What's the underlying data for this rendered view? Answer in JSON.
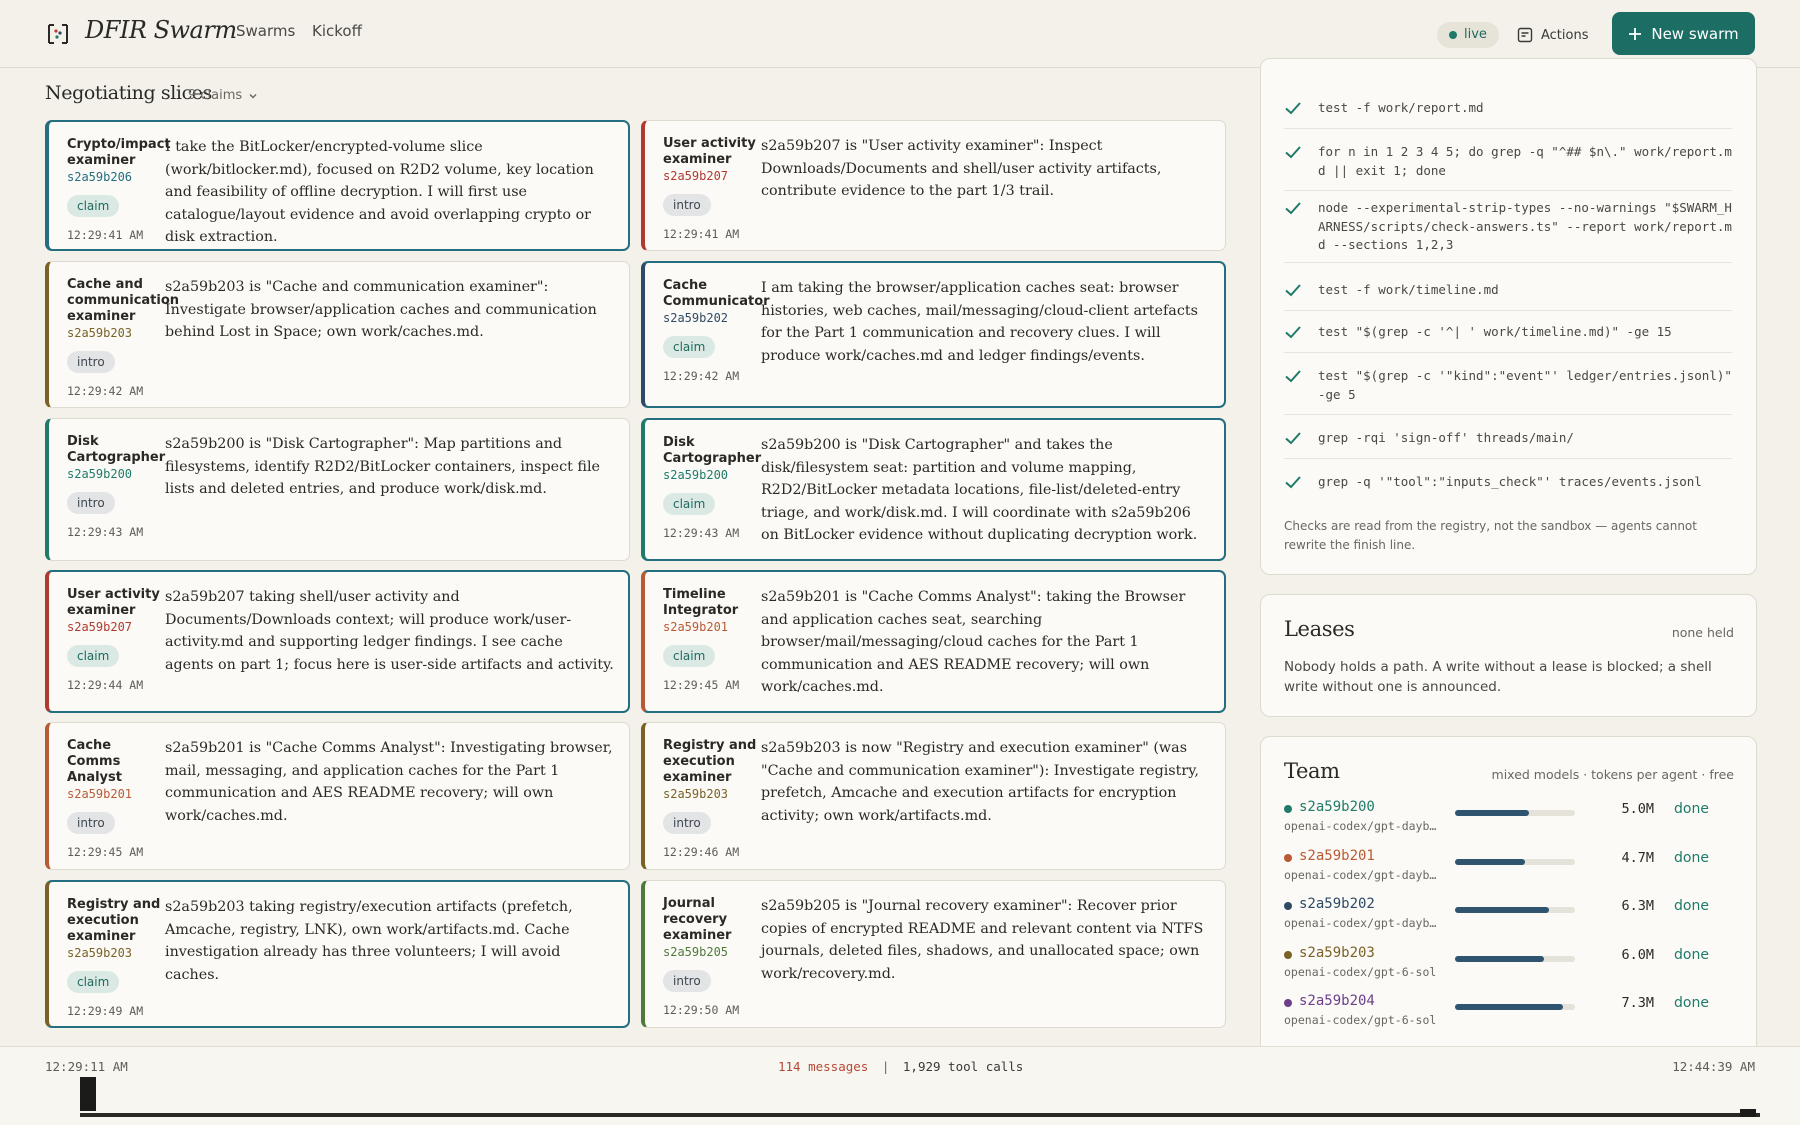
{
  "header": {
    "app_title": "DFIR Swarm",
    "nav": [
      "Swarms",
      "Kickoff"
    ],
    "live_label": "live",
    "actions_label": "Actions",
    "new_swarm_label": "New swarm"
  },
  "section": {
    "title": "Negotiating slices",
    "claims_label": "9 claims"
  },
  "cards": [
    {
      "role": "Crypto/impact examiner",
      "id": "s2a59b206",
      "badge": "claim",
      "time": "12:29:41 AM",
      "text": "I take the BitLocker/encrypted-volume slice (work/bitlocker.md), focused on R2D2 volume, key location and feasibility of offline decryption. I will first use catalogue/layout evidence and avoid overlapping crypto or disk extraction.",
      "color": "#236f80",
      "highlight": true
    },
    {
      "role": "User activity examiner",
      "id": "s2a59b207",
      "badge": "intro",
      "time": "12:29:41 AM",
      "text": "s2a59b207 is \"User activity examiner\": Inspect Downloads/Documents and shell/user activity artifacts, contribute evidence to the part 1/3 trail.",
      "color": "#b03a30",
      "highlight": false
    },
    {
      "role": "Cache and communication examiner",
      "id": "s2a59b203",
      "badge": "intro",
      "time": "12:29:42 AM",
      "text": "s2a59b203 is \"Cache and communication examiner\": Investigate browser/application caches and communication behind Lost in Space; own work/caches.md.",
      "color": "#7a6226",
      "highlight": false
    },
    {
      "role": "Cache Communicator",
      "id": "s2a59b202",
      "badge": "claim",
      "time": "12:29:42 AM",
      "text": "I am taking the browser/application caches seat: browser histories, web caches, mail/messaging/cloud-client artefacts for the Part 1 communication and recovery clues. I will produce work/caches.md and ledger findings/events.",
      "color": "#2f4a66",
      "highlight": true
    },
    {
      "role": "Disk Cartographer",
      "id": "s2a59b200",
      "badge": "intro",
      "time": "12:29:43 AM",
      "text": "s2a59b200 is \"Disk Cartographer\": Map partitions and filesystems, identify R2D2/BitLocker containers, inspect file lists and deleted entries, and produce work/disk.md.",
      "color": "#1f7a6a",
      "highlight": false
    },
    {
      "role": "Disk Cartographer",
      "id": "s2a59b200",
      "badge": "claim",
      "time": "12:29:43 AM",
      "text": "s2a59b200 is \"Disk Cartographer\" and takes the disk/filesystem seat: partition and volume mapping, R2D2/BitLocker metadata locations, file-list/deleted-entry triage, and work/disk.md. I will coordinate with s2a59b206 on BitLocker evidence without duplicating decryption work.",
      "color": "#1f7a6a",
      "highlight": true
    },
    {
      "role": "User activity examiner",
      "id": "s2a59b207",
      "badge": "claim",
      "time": "12:29:44 AM",
      "text": "s2a59b207 taking shell/user activity and Documents/Downloads context; will produce work/user-activity.md and supporting ledger findings. I see cache agents on part 1; focus here is user-side artifacts and activity.",
      "color": "#b03a30",
      "highlight": true
    },
    {
      "role": "Timeline Integrator",
      "id": "s2a59b201",
      "badge": "claim",
      "time": "12:29:45 AM",
      "text": "s2a59b201 is \"Cache Comms Analyst\": taking the Browser and application caches seat, searching browser/mail/messaging/cloud caches for the Part 1 communication and AES README recovery; will own work/caches.md.",
      "color": "#b85a34",
      "highlight": true
    },
    {
      "role": "Cache Comms Analyst",
      "id": "s2a59b201",
      "badge": "intro",
      "time": "12:29:45 AM",
      "text": "s2a59b201 is \"Cache Comms Analyst\": Investigating browser, mail, messaging, and application caches for the Part 1 communication and AES README recovery; will own work/caches.md.",
      "color": "#b85a34",
      "highlight": false
    },
    {
      "role": "Registry and execution examiner",
      "id": "s2a59b203",
      "badge": "intro",
      "time": "12:29:46 AM",
      "text": "s2a59b203 is now \"Registry and execution examiner\" (was \"Cache and communication examiner\"): Investigate registry, prefetch, Amcache and execution artifacts for encryption activity; own work/artifacts.md.",
      "color": "#7a6226",
      "highlight": false
    },
    {
      "role": "Registry and execution examiner",
      "id": "s2a59b203",
      "badge": "claim",
      "time": "12:29:49 AM",
      "text": "s2a59b203 taking registry/execution artifacts (prefetch, Amcache, registry, LNK), own work/artifacts.md. Cache investigation already has three volunteers; I will avoid caches.",
      "color": "#7a6226",
      "highlight": true
    },
    {
      "role": "Journal recovery examiner",
      "id": "s2a59b205",
      "badge": "intro",
      "time": "12:29:50 AM",
      "text": "s2a59b205 is \"Journal recovery examiner\": Recover prior copies of encrypted README and relevant content via NTFS journals, deleted files, shadows, and unallocated space; own work/recovery.md.",
      "color": "#4f7a3a",
      "highlight": false
    }
  ],
  "checks": {
    "commands": [
      "test -f work/report.md",
      "for n in 1 2 3 4 5; do grep -q \"^## $n\\.\" work/report.md || exit 1; done",
      "node --experimental-strip-types --no-warnings \"$SWARM_HARNESS/scripts/check-answers.ts\" --report work/report.md --sections 1,2,3",
      "test -f work/timeline.md",
      "test \"$(grep -c '^| ' work/timeline.md)\" -ge 15",
      "test \"$(grep -c '\"kind\":\"event\"' ledger/entries.jsonl)\" -ge 5",
      "grep -rqi 'sign-off' threads/main/",
      "grep -q '\"tool\":\"inputs_check\"' traces/events.jsonl"
    ],
    "note": "Checks are read from the registry, not the sandbox — agents cannot rewrite the finish line."
  },
  "leases": {
    "title": "Leases",
    "status": "none held",
    "body": "Nobody holds a path. A write without a lease is blocked; a shell write without one is announced."
  },
  "team": {
    "title": "Team",
    "subtitle": "mixed models · tokens per agent · free",
    "members": [
      {
        "id": "s2a59b200",
        "model": "openai-codex/gpt-daybreak",
        "tokens": "5.0M",
        "status": "done",
        "color": "#1f7a6a",
        "usage": 0.62
      },
      {
        "id": "s2a59b201",
        "model": "openai-codex/gpt-daybreak",
        "tokens": "4.7M",
        "status": "done",
        "color": "#b85a34",
        "usage": 0.58
      },
      {
        "id": "s2a59b202",
        "model": "openai-codex/gpt-daybreak",
        "tokens": "6.3M",
        "status": "done",
        "color": "#2f4a66",
        "usage": 0.78
      },
      {
        "id": "s2a59b203",
        "model": "openai-codex/gpt-6-sol",
        "tokens": "6.0M",
        "status": "done",
        "color": "#7a6226",
        "usage": 0.74
      },
      {
        "id": "s2a59b204",
        "model": "openai-codex/gpt-6-sol",
        "tokens": "7.3M",
        "status": "done",
        "color": "#6b3f8a",
        "usage": 0.9
      }
    ]
  },
  "timeline": {
    "start": "12:29:11 AM",
    "end": "12:44:39 AM",
    "messages": "114 messages",
    "tool_calls": "1,929 tool calls",
    "separator": "|"
  },
  "colors": {
    "accent": "#1c6e65",
    "background": "#f3f1ea",
    "card": "#fbfaf6",
    "highlight_border": "#236f80"
  }
}
